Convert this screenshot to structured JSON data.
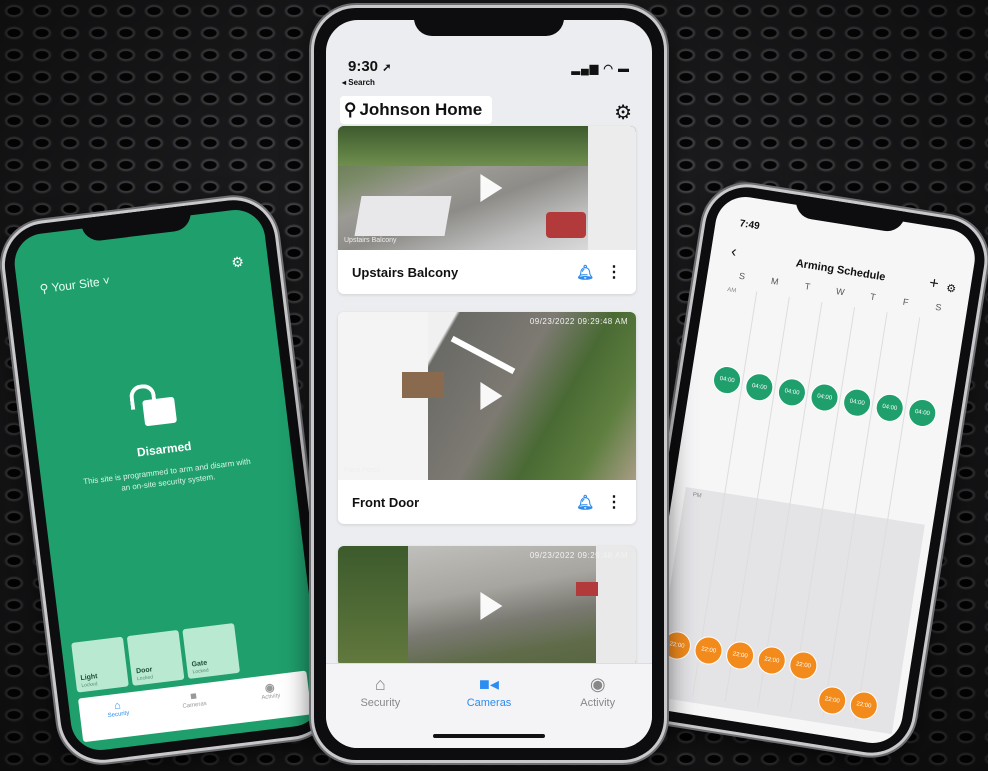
{
  "center": {
    "time": "9:30",
    "back_label": "◂ Search",
    "site_title": "Johnson Home",
    "cameras": [
      {
        "name": "Upstairs Balcony",
        "stamp": "Upstairs Balcony",
        "timestamp": ""
      },
      {
        "name": "Front Door",
        "stamp": "Front Porch",
        "timestamp": "09/23/2022 09:29:48 AM"
      },
      {
        "name": "",
        "stamp": "",
        "timestamp": "09/23/2022 09:29:48 AM"
      }
    ],
    "tabs": [
      {
        "label": "Security",
        "icon": "home-icon"
      },
      {
        "label": "Cameras",
        "icon": "video-camera-icon"
      },
      {
        "label": "Activity",
        "icon": "activity-icon"
      }
    ],
    "active_tab": "Cameras"
  },
  "left": {
    "site_label": "Your Site",
    "status": "Disarmed",
    "description": "This site is programmed to arm and disarm with an on-site security system.",
    "tiles": [
      {
        "label": "Light",
        "sub": "Locked"
      },
      {
        "label": "Door",
        "sub": "Locked"
      },
      {
        "label": "Gate",
        "sub": "Locked"
      }
    ],
    "tabs": [
      {
        "label": "Security"
      },
      {
        "label": "Cameras"
      },
      {
        "label": "Activity"
      }
    ]
  },
  "right": {
    "time": "7:49",
    "title": "Arming Schedule",
    "days": [
      "S",
      "M",
      "T",
      "W",
      "T",
      "F",
      "S"
    ],
    "am_label": "AM",
    "pm_label": "PM",
    "arm_times": [
      "04:00",
      "04:00",
      "04:00",
      "04:00",
      "04:00",
      "04:00",
      "04:00"
    ],
    "disarm_times": [
      "22:00",
      "22:00",
      "22:00",
      "22:00",
      "22:00",
      "22:00",
      "22:00"
    ]
  },
  "colors": {
    "brand_green": "#1f9f6c",
    "accent_blue": "#2d8cf0",
    "disarm_orange": "#f38b1c"
  }
}
